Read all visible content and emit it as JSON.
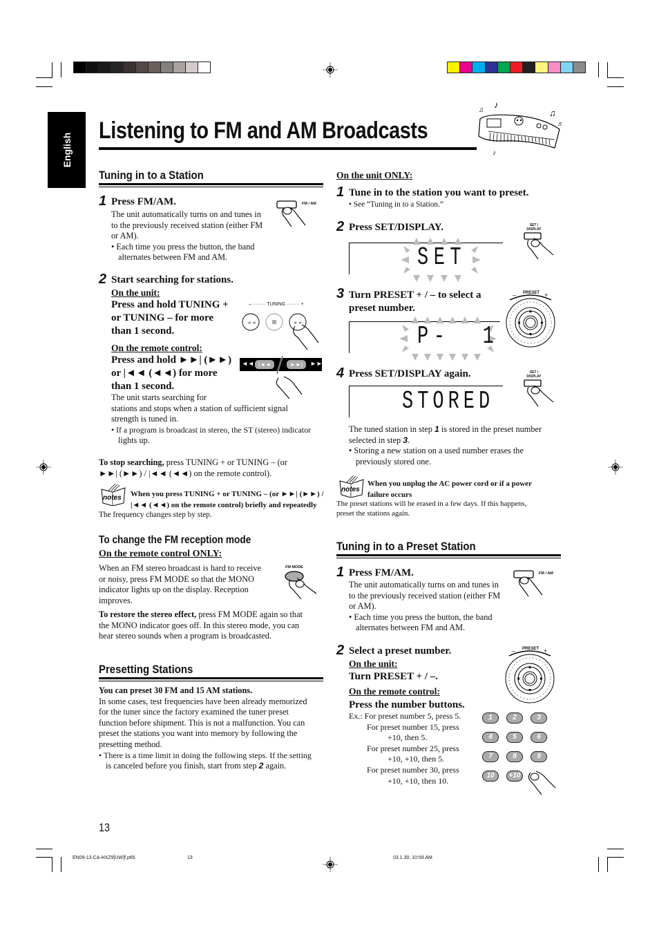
{
  "header": {
    "language_tab": "English",
    "title": "Listening to FM and AM Broadcasts",
    "registration_swatches_gray": [
      "#000000",
      "#111111",
      "#1a1a1a",
      "#262626",
      "#3b3332",
      "#534a48",
      "#6a5f5c",
      "#85807e",
      "#a8a2a0",
      "#d3cbca",
      "#ffffff"
    ],
    "registration_swatches_color": [
      "#fff200",
      "#ec008c",
      "#00aeef",
      "#2e3192",
      "#00a651",
      "#ed1c24",
      "#231f20",
      "#fff57a",
      "#f68dc6",
      "#7fd3f7",
      "#8c8c8c"
    ]
  },
  "left": {
    "tuning": {
      "heading": "Tuning in to a Station",
      "step1": {
        "num": "1",
        "title": "Press FM/AM.",
        "text": [
          "The unit automatically turns on and tunes in",
          "to the previously received station (either FM",
          "or AM)."
        ],
        "bullet": [
          "• Each time you press the button, the band",
          "alternates between FM and AM."
        ],
        "button_label": "FM / AM"
      },
      "step2": {
        "num": "2",
        "title": "Start searching for stations.",
        "unit_label": "On the unit:",
        "unit_text": [
          "Press and hold TUNING +",
          "or TUNING – for more",
          "than 1 second."
        ],
        "tuning_label": "– ········ TUNING ········ +",
        "remote_label": "On the remote control:",
        "remote_text": [
          "Press and hold ►►| (►►)",
          "or |◄◄ (◄◄) for more",
          "than 1 second."
        ],
        "remote_buttons": [
          "◄◄",
          "|◄◄",
          "►►|",
          "►►"
        ],
        "result": [
          "The unit starts searching for",
          "stations and stops when a station of sufficient signal",
          "strength is tuned in."
        ],
        "bullet": [
          "• If a program is broadcast in stereo, the ST (stereo) indicator",
          "lights up."
        ]
      },
      "stop": {
        "bold": "To stop searching,",
        "text1": " press TUNING + or TUNING – (or",
        "text2": "►►| (►►) / |◄◄ (◄◄) on the remote control)."
      },
      "note": {
        "icon_label": "notes",
        "bold": [
          "When you press TUNING + or TUNING – (or ►►| (►►) /",
          "|◄◄ (◄◄) on the remote control) briefly and repeatedly"
        ],
        "text": "The frequency changes step by step."
      }
    },
    "fm_mode": {
      "heading": "To change the FM reception mode",
      "sub": "On the remote control ONLY:",
      "text": [
        "When an FM stereo broadcast is hard to receive",
        "or noisy, press FM MODE so that the MONO",
        "indicator lights up on the display. Reception",
        "improves."
      ],
      "button_label": "FM MODE",
      "restore_bold": "To restore the stereo effect,",
      "restore": [
        " press FM MODE again so that",
        "the MONO indicator goes off. In this stereo mode, you can",
        "hear stereo sounds when a program is broadcasted."
      ]
    },
    "presetting": {
      "heading": "Presetting Stations",
      "bold": "You can preset 30 FM and 15 AM stations.",
      "text": [
        "In some cases, test frequencies have been already memorized",
        "for the tuner since the factory examined the tuner preset",
        "function before shipment. This is not a malfunction. You can",
        "preset the stations you want into memory by following the",
        "presetting method."
      ],
      "bullet1": "• There is a time limit in doing the following steps. If the setting",
      "bullet2a": "is canceled before you finish, start from step ",
      "bullet2num": "2",
      "bullet2b": " again."
    }
  },
  "right": {
    "preset": {
      "sub": "On the unit ONLY:",
      "step1": {
        "num": "1",
        "title": "Tune in to the station you want to preset.",
        "bullet": "• See “Tuning in to a Station.”"
      },
      "step2": {
        "num": "2",
        "title": "Press SET/DISPLAY.",
        "display": "SET",
        "button_label": "SET / DISPLAY"
      },
      "step3": {
        "num": "3",
        "title1": "Turn PRESET + / – to select a",
        "title2": "preset number.",
        "display": "P-  1",
        "dial_label": "PRESET",
        "dial_minus": "–",
        "dial_plus": "+"
      },
      "step4": {
        "num": "4",
        "title": "Press SET/DISPLAY again.",
        "display": "STORED",
        "button_label": "SET / DISPLAY"
      },
      "result1a": "The tuned station in step ",
      "result1n": "1",
      "result1b": " is stored in the preset number",
      "result2a": "selected in step ",
      "result2n": "3",
      "result2b": ".",
      "bullet": [
        "• Storing a new station on a used number erases the",
        "previously stored one."
      ],
      "note": {
        "icon_label": "notes",
        "bold": [
          "When you unplug the AC power cord or if a power",
          "failure occurs"
        ],
        "text": [
          "The preset stations will be erased in a few days. If this happens,",
          "preset the stations again."
        ]
      }
    },
    "preset_station": {
      "heading": "Tuning in to a Preset Station",
      "step1": {
        "num": "1",
        "title": "Press FM/AM.",
        "text": [
          "The unit automatically turns on and tunes in",
          "to the previously received station (either FM",
          "or AM)."
        ],
        "bullet": [
          "• Each time you press the button, the band",
          "alternates between FM and AM."
        ],
        "button_label": "FM / AM"
      },
      "step2": {
        "num": "2",
        "title": "Select a preset number.",
        "unit_label": "On the unit:",
        "unit_text": "Turn PRESET + / –.",
        "remote_label": "On the remote control:",
        "remote_text": "Press the number buttons.",
        "examples": [
          "Ex.: For preset number 5, press 5.",
          "For preset number 15, press",
          "+10, then 5.",
          "For preset number 25, press",
          "+10, +10, then 5.",
          "For preset number 30, press",
          "+10, +10, then 10."
        ],
        "keypad": [
          "1",
          "2",
          "3",
          "4",
          "5",
          "6",
          "7",
          "8",
          "9",
          "10",
          "+10"
        ]
      }
    }
  },
  "footer": {
    "page_number": "13",
    "file": "EN09-13.CA-HXZ9[UW]f.p65",
    "file_page": "13",
    "timestamp": "03.1.30, 10:59 AM"
  }
}
